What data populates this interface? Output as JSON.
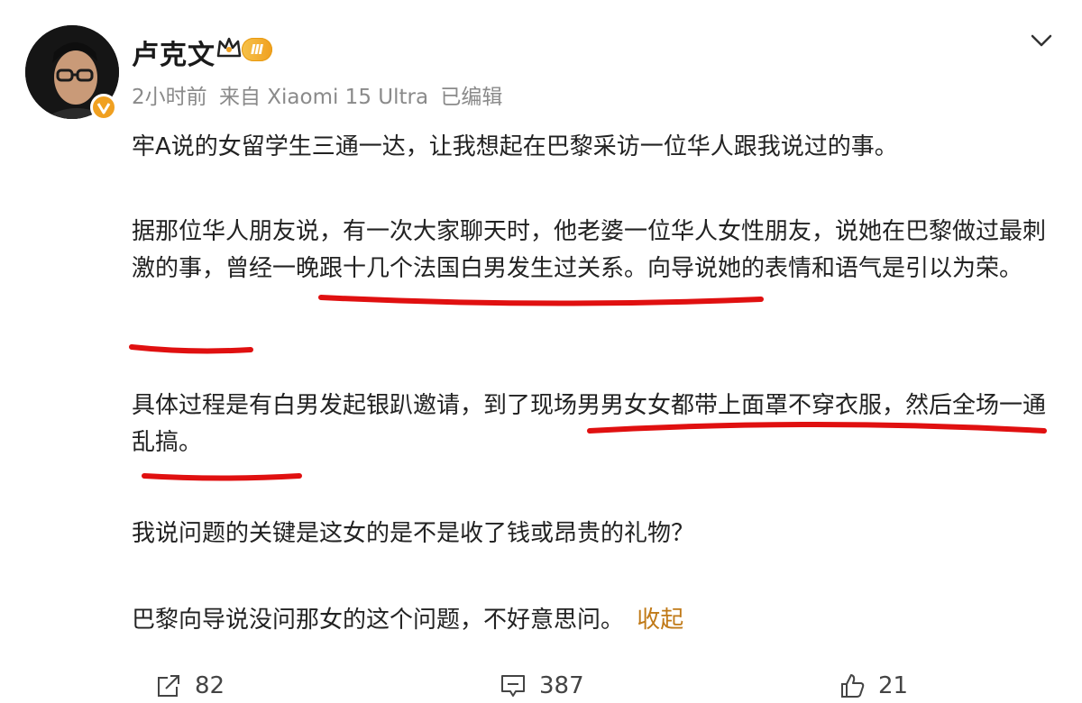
{
  "header": {
    "username": "卢克文",
    "level_badge": "Ⅲ",
    "meta": {
      "time": "2小时前",
      "source": "来自 Xiaomi 15 Ultra",
      "edited": "已编辑"
    }
  },
  "post": {
    "paragraphs": [
      "牢A说的女留学生三通一达，让我想起在巴黎采访一位华人跟我说过的事。",
      "据那位华人朋友说，有一次大家聊天时，他老婆一位华人女性朋友，说她在巴黎做过最刺激的事，曾经一晚跟十几个法国白男发生过关系。向导说她的表情和语气是引以为荣。",
      "具体过程是有白男发起银趴邀请，到了现场男男女女都带上面罩不穿衣服，然后全场一通乱搞。",
      "我说问题的关键是这女的是不是收了钱或昂贵的礼物？",
      "巴黎向导说没问那女的这个问题，不好意思问。"
    ],
    "collapse_label": "收起"
  },
  "actions": {
    "repost_count": "82",
    "comment_count": "387",
    "like_count": "21"
  },
  "icons": {
    "crown": "crown-icon",
    "verified": "verified-icon",
    "chevron": "chevron-down-icon",
    "repost": "repost-icon",
    "comment": "comment-icon",
    "like": "like-icon"
  },
  "colors": {
    "accent_orange": "#f0a020",
    "collapse_link": "#c07a18",
    "meta_gray": "#8a8a8a",
    "highlight_red": "#e01010"
  }
}
